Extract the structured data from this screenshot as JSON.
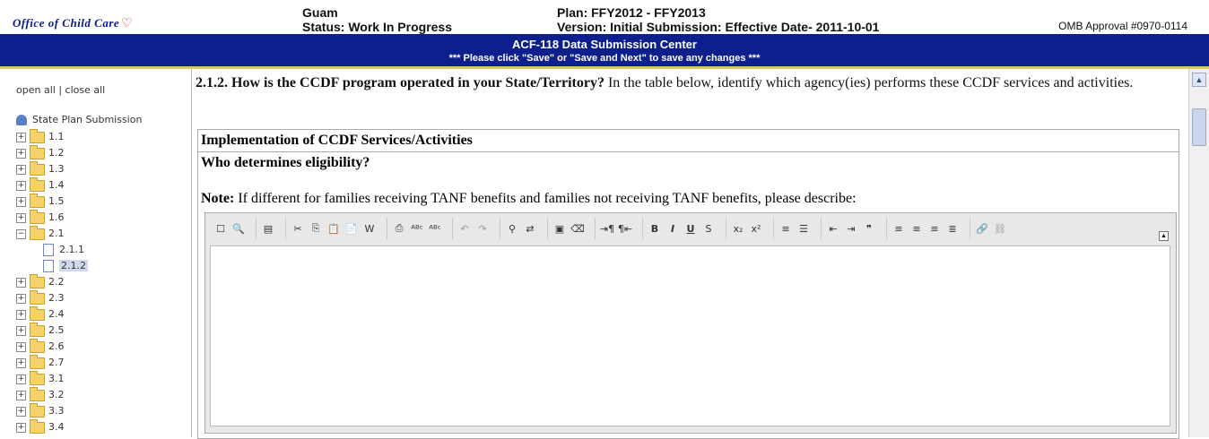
{
  "header": {
    "logo_text": "Office of Child Care",
    "state": "Guam",
    "status": "Status: Work In Progress",
    "plan": "Plan: FFY2012 - FFY2013",
    "version": "Version: Initial Submission: Effective Date- 2011-10-01",
    "omb": "OMB Approval #0970-0114"
  },
  "banner": {
    "title": "ACF-118 Data Submission Center",
    "subtitle": "*** Please click \"Save\" or \"Save and Next\" to save any changes ***"
  },
  "sidebar": {
    "open_all": "open all",
    "separator": "|",
    "close_all": "close all",
    "root": "State Plan Submission",
    "items": [
      {
        "label": "1.1",
        "expanded": false
      },
      {
        "label": "1.2",
        "expanded": false
      },
      {
        "label": "1.3",
        "expanded": false
      },
      {
        "label": "1.4",
        "expanded": false
      },
      {
        "label": "1.5",
        "expanded": false
      },
      {
        "label": "1.6",
        "expanded": false
      },
      {
        "label": "2.1",
        "expanded": true,
        "children": [
          "2.1.1",
          "2.1.2"
        ]
      },
      {
        "label": "2.2",
        "expanded": false
      },
      {
        "label": "2.3",
        "expanded": false
      },
      {
        "label": "2.4",
        "expanded": false
      },
      {
        "label": "2.5",
        "expanded": false
      },
      {
        "label": "2.6",
        "expanded": false
      },
      {
        "label": "2.7",
        "expanded": false
      },
      {
        "label": "3.1",
        "expanded": false
      },
      {
        "label": "3.2",
        "expanded": false
      },
      {
        "label": "3.3",
        "expanded": false
      },
      {
        "label": "3.4",
        "expanded": false
      }
    ],
    "selected": "2.1.2"
  },
  "main": {
    "question_number": "2.1.2.",
    "question_bold": "How is the CCDF program operated in your State/Territory?",
    "question_rest": " In the table below, identify which agency(ies) performs these CCDF services and activities.",
    "table_title": "Implementation of CCDF Services/Activities",
    "sub_title": "Who determines eligibility?",
    "note_label": "Note:",
    "note_text": " If different for families receiving TANF benefits and families not receiving TANF benefits, please describe:"
  },
  "editor": {
    "toolbar_groups": [
      [
        "new-page-icon",
        "preview-icon"
      ],
      [
        "templates-icon"
      ],
      [
        "cut-icon",
        "copy-icon",
        "paste-icon",
        "paste-text-icon",
        "paste-word-icon"
      ],
      [
        "print-icon",
        "spellcheck-icon",
        "spellcheck-as-you-type-icon"
      ],
      [
        "undo-icon",
        "redo-icon"
      ],
      [
        "find-icon",
        "replace-icon"
      ],
      [
        "select-all-icon",
        "remove-format-icon"
      ],
      [
        "ltr-icon",
        "rtl-icon"
      ],
      [
        "bold-icon",
        "italic-icon",
        "underline-icon",
        "strike-icon"
      ],
      [
        "subscript-icon",
        "superscript-icon"
      ],
      [
        "numbered-list-icon",
        "bulleted-list-icon"
      ],
      [
        "outdent-icon",
        "indent-icon",
        "blockquote-icon"
      ],
      [
        "align-left-icon",
        "align-center-icon",
        "align-right-icon",
        "justify-icon"
      ],
      [
        "link-icon",
        "unlink-icon"
      ]
    ],
    "content": ""
  }
}
